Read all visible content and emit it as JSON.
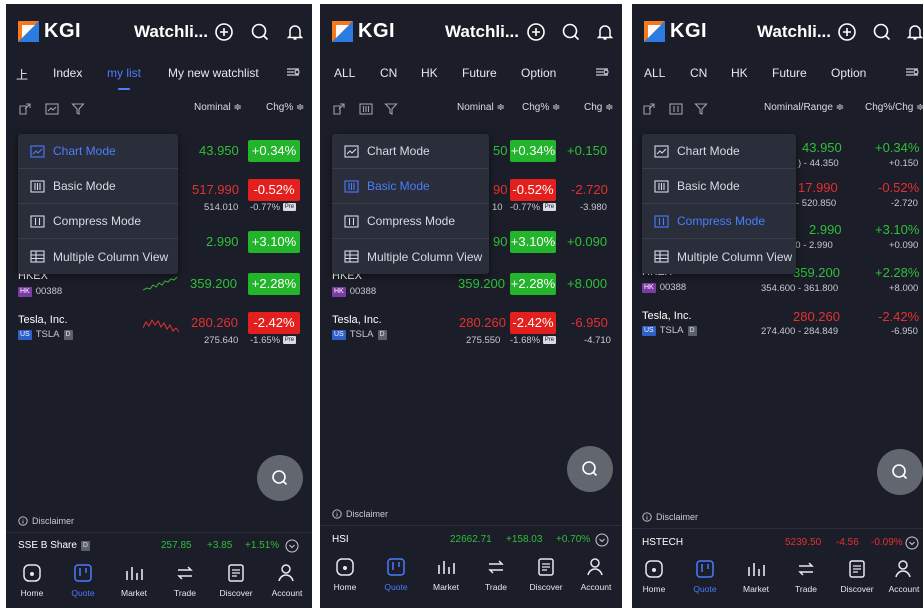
{
  "colors": {
    "bg": "#1b1d28",
    "accent": "#4b7dff",
    "up": "#22b42a",
    "down": "#e3201d"
  },
  "brand": "KGI",
  "panels": [
    {
      "title": "Watchli...",
      "tabs": [
        "上",
        "Index",
        "my list",
        "My new watchlist"
      ],
      "active_tab": "my list",
      "col_headers": [
        "Nominal ≑",
        "Chg% ≑"
      ],
      "menu": [
        "Chart Mode",
        "Basic Mode",
        "Compress Mode",
        "Multiple Column View"
      ],
      "selected_menu": "Chart Mode",
      "rows": [
        {
          "price": "43.950",
          "chg": "+0.34%"
        },
        {
          "price": "517.990",
          "chg": "-0.52%",
          "sub": "514.010",
          "subchg": "-0.77%",
          "pre": "Pre"
        },
        {
          "price": "2.990",
          "chg": "+3.10%"
        },
        {
          "name": "HKEX",
          "market": "HK",
          "code": "00388",
          "price": "359.200",
          "chg": "+2.28%"
        },
        {
          "name": "Tesla, Inc.",
          "market": "US",
          "code": "TSLA",
          "d": "D",
          "price": "280.260",
          "chg": "-2.42%",
          "sub": "275.640",
          "subchg": "-1.65%",
          "pre": "Pre"
        }
      ],
      "disclaimer": "Disclaimer",
      "ticker": {
        "name": "SSE B Share",
        "d": "D",
        "value": "257.85",
        "change": "+3.85",
        "pct": "+1.51%"
      }
    },
    {
      "title": "Watchli...",
      "tabs": [
        "ALL",
        "CN",
        "HK",
        "Future",
        "Option"
      ],
      "col_headers": [
        "Nominal ≑",
        "Chg% ≑",
        "Chg ≑"
      ],
      "menu": [
        "Chart Mode",
        "Basic Mode",
        "Compress Mode",
        "Multiple Column View"
      ],
      "selected_menu": "Basic Mode",
      "rows": [
        {
          "price": "50",
          "chg": "+0.34%",
          "chgv": "+0.150"
        },
        {
          "price": "90",
          "chg": "-0.52%",
          "chgv": "-2.720",
          "sub": "10",
          "subchg": "-0.77%",
          "pre": "Pre",
          "subv": "-3.980"
        },
        {
          "price": "90",
          "chg": "+3.10%",
          "chgv": "+0.090"
        },
        {
          "name": "HKEX",
          "market": "HK",
          "code": "00388",
          "price": "359.200",
          "chg": "+2.28%",
          "chgv": "+8.000"
        },
        {
          "name": "Tesla, Inc.",
          "market": "US",
          "code": "TSLA",
          "d": "D",
          "price": "280.260",
          "chg": "-2.42%",
          "chgv": "-6.950",
          "sub": "275.550",
          "subchg": "-1.68%",
          "pre": "Pre",
          "subv": "-4.710"
        }
      ],
      "disclaimer": "Disclaimer",
      "ticker": {
        "name": "HSI",
        "value": "22662.71",
        "change": "+158.03",
        "pct": "+0.70%"
      }
    },
    {
      "title": "Watchli...",
      "tabs": [
        "ALL",
        "CN",
        "HK",
        "Future",
        "Option"
      ],
      "col_headers": [
        "Nominal/Range ≑",
        "Chg%/Chg ≑"
      ],
      "menu": [
        "Chart Mode",
        "Basic Mode",
        "Compress Mode",
        "Multiple Column View"
      ],
      "selected_menu": "Compress Mode",
      "rows": [
        {
          "price": "43.950",
          "chg": "+0.34%",
          "range": ") - 44.350",
          "chgv": "+0.150"
        },
        {
          "price": "17.990",
          "chg": "-0.52%",
          "range": "- 520.850",
          "chgv": "-2.720"
        },
        {
          "price": "2.990",
          "chg": "+3.10%",
          "range": "20 - 2.990",
          "chgv": "+0.090"
        },
        {
          "name": "HKEX",
          "market": "HK",
          "code": "00388",
          "price": "359.200",
          "chg": "+2.28%",
          "range": "354.600 - 361.800",
          "chgv": "+8.000"
        },
        {
          "name": "Tesla, Inc.",
          "market": "US",
          "code": "TSLA",
          "d": "D",
          "price": "280.260",
          "chg": "-2.42%",
          "range": "274.400 - 284.849",
          "chgv": "-6.950"
        }
      ],
      "disclaimer": "Disclaimer",
      "ticker": {
        "name": "HSTECH",
        "value": "5239.50",
        "change": "-4.56",
        "pct": "-0.09%"
      }
    }
  ],
  "nav": [
    "Home",
    "Quote",
    "Market",
    "Trade",
    "Discover",
    "Account"
  ],
  "nav_active": "Quote"
}
